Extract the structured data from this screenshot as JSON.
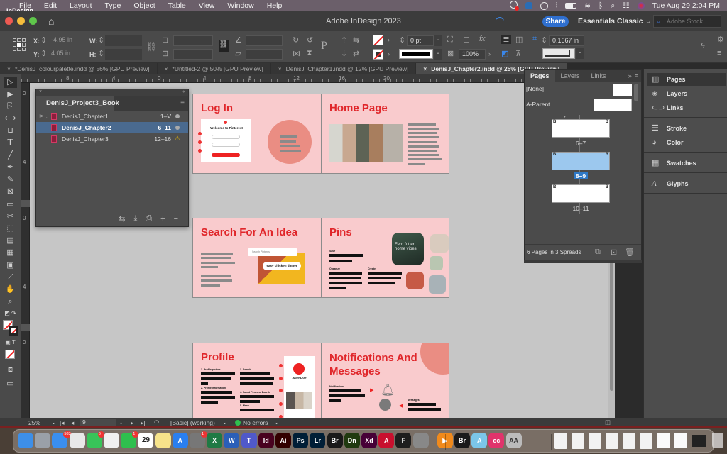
{
  "menubar": {
    "app_name": "InDesign",
    "items": [
      "File",
      "Edit",
      "Layout",
      "Type",
      "Object",
      "Table",
      "View",
      "Window",
      "Help"
    ],
    "datetime": "Tue Aug 29  2:04 PM"
  },
  "titlebar": {
    "title": "Adobe InDesign 2023",
    "share_label": "Share",
    "workspace": "Essentials Classic",
    "stock_placeholder": "Adobe Stock"
  },
  "control": {
    "x_label": "X:",
    "x_value": "-4.95 in",
    "y_label": "Y:",
    "y_value": "4.05 in",
    "w_label": "W:",
    "h_label": "H:",
    "stroke_weight": "0 pt",
    "opacity": "100%",
    "gutter": "0.1667 in"
  },
  "tabs": [
    {
      "label": "*DenisJ_colourpalette.indd @ 56% [GPU Preview]",
      "active": false
    },
    {
      "label": "*Untitled-2 @ 50% [GPU Preview]",
      "active": false
    },
    {
      "label": "DenisJ_Chapter1.indd @ 12% [GPU Preview]",
      "active": false
    },
    {
      "label": "DenisJ_Chapter2.indd @ 25% [GPU Preview]",
      "active": true
    }
  ],
  "ruler": {
    "h_ticks": [
      "8",
      "4",
      "0",
      "4",
      "8",
      "12",
      "16",
      "20"
    ],
    "v_ticks": [
      "0",
      "4",
      "0",
      "4",
      "0"
    ]
  },
  "book_panel": {
    "title": "DenisJ_Project3_Book",
    "chapters": [
      {
        "name": "DenisJ_Chapter1",
        "pages": "1–V",
        "status": "ok"
      },
      {
        "name": "DenisJ_Chapter2",
        "pages": "6–11",
        "status": "ok",
        "selected": true
      },
      {
        "name": "DenisJ_Chapter3",
        "pages": "12–16",
        "status": "warning"
      }
    ]
  },
  "spreads": [
    {
      "left_title": "Log In",
      "right_title": "Home Page",
      "login_card_title": "Welcome to Pinterest"
    },
    {
      "left_title": "Search For An Idea",
      "right_title": "Pins",
      "search_query": "easy chicken dinner",
      "search_placeholder": "Search Pinterest",
      "pins_image_text": "Fern futter home vibes",
      "pins_labels": [
        "Save",
        "Organize",
        "Create"
      ]
    },
    {
      "left_title": "Profile",
      "right_title": "Notifications And Messages",
      "profile_name": "Jane Doe",
      "profile_labels": [
        "1. Profile picture",
        "2. Profile information",
        "3. Search",
        "4. Saved Pins and Boards",
        "5. Menu"
      ],
      "notif_labels": [
        "Notifications",
        "Messages"
      ]
    }
  ],
  "pages_panel": {
    "tabs": [
      "Pages",
      "Layers",
      "Links"
    ],
    "parents": [
      "[None]",
      "A-Parent"
    ],
    "spreads": [
      {
        "label": "6–7",
        "selected": false
      },
      {
        "label": "8–9",
        "selected": true
      },
      {
        "label": "10–11",
        "selected": false
      }
    ],
    "footer": "6 Pages in 3 Spreads"
  },
  "dock_panels": [
    {
      "label": "Pages",
      "icon": "pages-icon",
      "active": true
    },
    {
      "label": "Layers",
      "icon": "layers-icon"
    },
    {
      "label": "Links",
      "icon": "links-icon"
    },
    {
      "label": "Stroke",
      "icon": "stroke-icon"
    },
    {
      "label": "Color",
      "icon": "color-icon"
    },
    {
      "label": "Swatches",
      "icon": "swatches-icon"
    },
    {
      "label": "Glyphs",
      "icon": "glyphs-icon"
    }
  ],
  "status": {
    "zoom": "25%",
    "page": "9",
    "preflight_profile": "[Basic] (working)",
    "errors": "No errors"
  },
  "dock": {
    "apps": [
      {
        "name": "Finder",
        "color": "#3d8fe8",
        "label": ""
      },
      {
        "name": "Launchpad",
        "color": "#9aa0a8",
        "label": ""
      },
      {
        "name": "Mail",
        "color": "#3a8ff0",
        "label": "",
        "badge": "583"
      },
      {
        "name": "Chrome",
        "color": "#e8e8e8",
        "label": ""
      },
      {
        "name": "Messages",
        "color": "#38c359",
        "label": "",
        "badge": "6"
      },
      {
        "name": "Photos",
        "color": "#f0f0f0",
        "label": ""
      },
      {
        "name": "FaceTime",
        "color": "#2fbf4e",
        "label": "",
        "badge": "1"
      },
      {
        "name": "Calendar",
        "color": "#ffffff",
        "label": "29"
      },
      {
        "name": "Notes",
        "color": "#f7e38a",
        "label": ""
      },
      {
        "name": "App Store",
        "color": "#2a7ff0",
        "label": "A"
      },
      {
        "name": "System Settings",
        "color": "#777",
        "label": "",
        "badge": "1"
      },
      {
        "name": "Excel",
        "color": "#1f7a44",
        "label": "X"
      },
      {
        "name": "Word",
        "color": "#2b5fb8",
        "label": "W"
      },
      {
        "name": "Teams",
        "color": "#5059c9",
        "label": "T"
      },
      {
        "name": "InDesign",
        "color": "#49021f",
        "label": "Id"
      },
      {
        "name": "Illustrator",
        "color": "#330000",
        "label": "Ai"
      },
      {
        "name": "Photoshop",
        "color": "#001e36",
        "label": "Ps"
      },
      {
        "name": "Lightroom",
        "color": "#001e36",
        "label": "Lr"
      },
      {
        "name": "Bridge",
        "color": "#1a1a1a",
        "label": "Br"
      },
      {
        "name": "Dimension",
        "color": "#203a10",
        "label": "Dn"
      },
      {
        "name": "XD",
        "color": "#470137",
        "label": "Xd"
      },
      {
        "name": "Acrobat",
        "color": "#c8102e",
        "label": "A"
      },
      {
        "name": "Figma",
        "color": "#1e1e1e",
        "label": "F"
      },
      {
        "name": "Screenshot",
        "color": "#888",
        "label": ""
      },
      {
        "name": "Infuse",
        "color": "#f08a1c",
        "label": "▶"
      },
      {
        "name": "Bridge 2",
        "color": "#1a1a1a",
        "label": "Br"
      },
      {
        "name": "Maps",
        "color": "#7bc6e8",
        "label": "A"
      },
      {
        "name": "Creative Cloud",
        "color": "#e0336b",
        "label": "cc"
      },
      {
        "name": "Font Book",
        "color": "#bbbbbb",
        "label": "AA"
      }
    ]
  },
  "colors": {
    "page_pink": "#f9cbcd",
    "title_red": "#e0262a",
    "selection_blue": "#4a6a8f",
    "accent_blue": "#2f6fcf"
  }
}
